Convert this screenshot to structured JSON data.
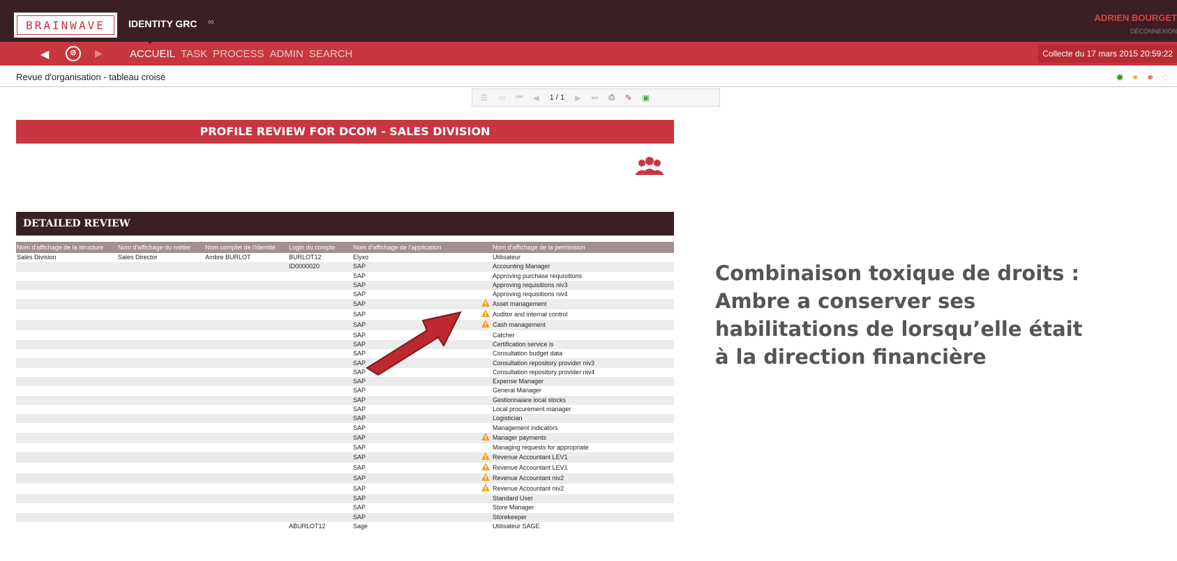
{
  "app": {
    "logo_text": "BRAINWAVE",
    "name": "IDENTITY GRC",
    "infinity": "∞",
    "user_name": "ADRIEN BOURGET",
    "logout": "DÉCONNEXION"
  },
  "nav": {
    "items": [
      "ACCUEIL",
      "TASK",
      "PROCESS",
      "ADMIN",
      "SEARCH"
    ],
    "collect_label": "Collecte du 17 mars 2015 20:59:22"
  },
  "page": {
    "title": "Revue d'organisation - tableau croisé",
    "pagination": "1 / 1"
  },
  "report": {
    "title": "PROFILE REVIEW FOR DCOM - SALES DIVISION",
    "section_title": "DETAILED REVIEW",
    "columns": [
      "Nom d'affichage de la structure",
      "Nom d'affichage du métier",
      "Nom complet de l'identité",
      "Login du compte",
      "Nom d'affichage de l'application",
      "",
      "Nom d'affichage de la permission"
    ],
    "rows": [
      [
        "Sales Division",
        "Sales Director",
        "Ambre BURLOT",
        "BURLOT12",
        "Elyxo",
        "",
        "Utilisateur"
      ],
      [
        "",
        "",
        "",
        "ID0000020",
        "SAP",
        "",
        "Accounting Manager"
      ],
      [
        "",
        "",
        "",
        "",
        "SAP",
        "",
        "Approving purchase requisitions"
      ],
      [
        "",
        "",
        "",
        "",
        "SAP",
        "",
        "Approving requisitions niv3"
      ],
      [
        "",
        "",
        "",
        "",
        "SAP",
        "",
        "Approving requisitions niv4"
      ],
      [
        "",
        "",
        "",
        "",
        "SAP",
        "warn",
        "Asset management"
      ],
      [
        "",
        "",
        "",
        "",
        "SAP",
        "warn",
        "Auditor and internal control"
      ],
      [
        "",
        "",
        "",
        "",
        "SAP",
        "warn",
        "Cash management"
      ],
      [
        "",
        "",
        "",
        "",
        "SAP",
        "",
        "Catcher"
      ],
      [
        "",
        "",
        "",
        "",
        "SAP",
        "",
        "Certification service is"
      ],
      [
        "",
        "",
        "",
        "",
        "SAP",
        "",
        "Consultation budget data"
      ],
      [
        "",
        "",
        "",
        "",
        "SAP",
        "",
        "Consultation repository provider niv3"
      ],
      [
        "",
        "",
        "",
        "",
        "SAP",
        "",
        "Consultation repository provider niv4"
      ],
      [
        "",
        "",
        "",
        "",
        "SAP",
        "",
        "Expense Manager"
      ],
      [
        "",
        "",
        "",
        "",
        "SAP",
        "",
        "General Manager"
      ],
      [
        "",
        "",
        "",
        "",
        "SAP",
        "",
        "Gestionnaiare local stocks"
      ],
      [
        "",
        "",
        "",
        "",
        "SAP",
        "",
        "Local procurement manager"
      ],
      [
        "",
        "",
        "",
        "",
        "SAP",
        "",
        "Logistician"
      ],
      [
        "",
        "",
        "",
        "",
        "SAP",
        "",
        "Management indicators"
      ],
      [
        "",
        "",
        "",
        "",
        "SAP",
        "warn",
        "Manager payments"
      ],
      [
        "",
        "",
        "",
        "",
        "SAP",
        "",
        "Managing requests for appropriate"
      ],
      [
        "",
        "",
        "",
        "",
        "SAP",
        "warn",
        "Revenue Accountant LEV1"
      ],
      [
        "",
        "",
        "",
        "",
        "SAP",
        "warn",
        "Revenue Accountant LEV1"
      ],
      [
        "",
        "",
        "",
        "",
        "SAP",
        "warn",
        "Revenue Accountant niv2"
      ],
      [
        "",
        "",
        "",
        "",
        "SAP",
        "warn",
        "Revenue Accountant niv2"
      ],
      [
        "",
        "",
        "",
        "",
        "SAP",
        "",
        "Standard User"
      ],
      [
        "",
        "",
        "",
        "",
        "SAP",
        "",
        "Store Manager"
      ],
      [
        "",
        "",
        "",
        "",
        "SAP",
        "",
        "Storekeeper"
      ],
      [
        "",
        "",
        "",
        "ABURLOT12",
        "Sage",
        "",
        "Utilisateur SAGE"
      ]
    ]
  },
  "callout": {
    "lines": [
      "Combinaison toxique de droits :",
      "Ambre a conserver ses",
      "habilitations de lorsqu’elle était",
      "à la direction financière"
    ]
  },
  "colors": {
    "brand_red": "#c8363f",
    "dark_header": "#3a2024",
    "table_header": "#a48e90",
    "warning": "#f0a020",
    "callout_text": "#555555"
  },
  "icons": {
    "nav_back": "back-arrow-icon",
    "nav_home": "compass-icon",
    "report_icon": "users-group-icon",
    "row_warning": "warning-icon"
  }
}
